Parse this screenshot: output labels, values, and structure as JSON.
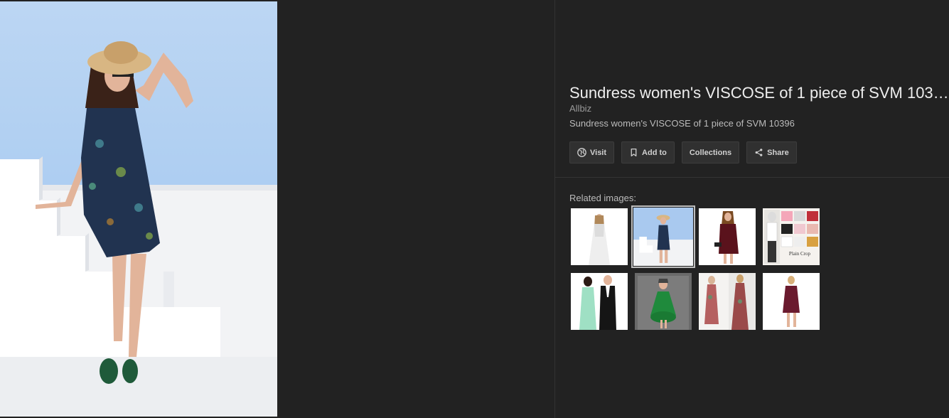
{
  "result": {
    "title": "Sundress women's VISCOSE of 1 piece of SVM 103…",
    "source": "Allbiz",
    "description": "Sundress women's VISCOSE of 1 piece of SVM 10396"
  },
  "actions": {
    "visit": {
      "label": "Visit",
      "icon": "globe-icon"
    },
    "add_to": {
      "label": "Add to",
      "icon": "bookmark-icon"
    },
    "collections": {
      "label": "Collections"
    },
    "share": {
      "label": "Share",
      "icon": "share-icon"
    }
  },
  "related": {
    "label": "Related images:",
    "thumbnails": [
      {
        "name": "white-gown",
        "selected": false
      },
      {
        "name": "floral-sundress",
        "selected": true
      },
      {
        "name": "red-lace-dress",
        "selected": false
      },
      {
        "name": "plain-crop-tops",
        "selected": false,
        "overlay_text": "Plain Crop"
      },
      {
        "name": "couple-formal",
        "selected": false
      },
      {
        "name": "green-strapless-dress",
        "selected": false
      },
      {
        "name": "floral-maxi-dresses",
        "selected": false
      },
      {
        "name": "burgundy-wrap-dress",
        "selected": false
      }
    ]
  },
  "colors": {
    "background": "#222222",
    "button_bg": "#303030",
    "divider": "#333333"
  }
}
